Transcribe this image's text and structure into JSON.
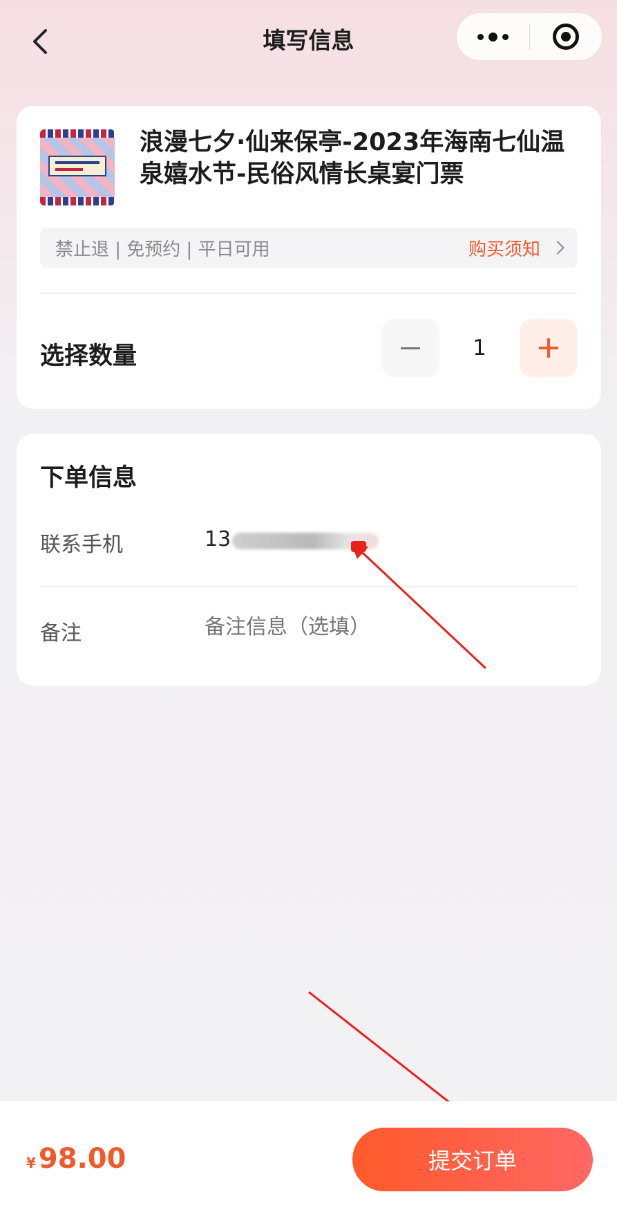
{
  "nav": {
    "title": "填写信息",
    "icons": {
      "back": "chevron-left-icon",
      "more": "more-dots-icon",
      "close": "target-close-icon"
    }
  },
  "product": {
    "title": "浪漫七夕·仙来保亭-2023年海南七仙温泉嬉水节-民俗风情长桌宴门票",
    "tags": "禁止退 | 免预约 | 平日可用",
    "notice_link": "购买须知"
  },
  "quantity": {
    "label": "选择数量",
    "value": "1"
  },
  "order_info": {
    "title": "下单信息",
    "phone_label": "联系手机",
    "phone_value": "13",
    "remark_label": "备注",
    "remark_placeholder": "备注信息（选填）"
  },
  "footer": {
    "currency": "¥",
    "price": "98.00",
    "submit_label": "提交订单"
  },
  "colors": {
    "accent": "#f05a2a",
    "submit_gradient_start": "#ff5a2b",
    "submit_gradient_end": "#ff6763",
    "annotation_arrow": "#e8221b"
  }
}
